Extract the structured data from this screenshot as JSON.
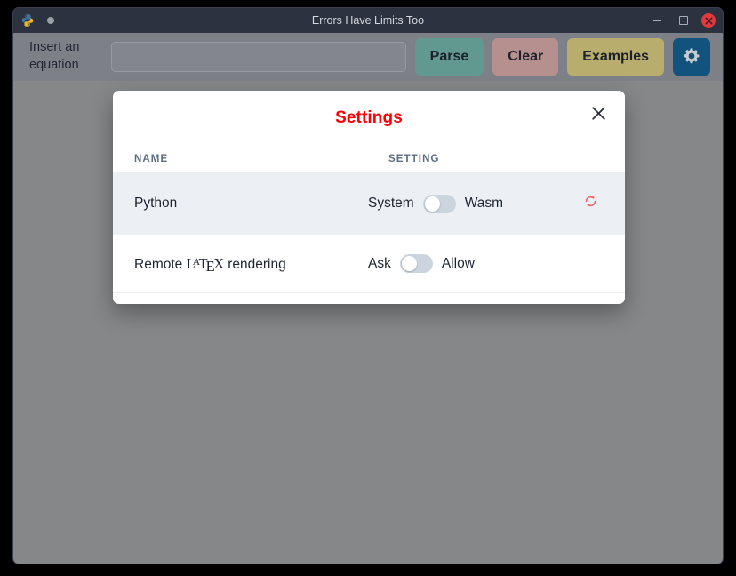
{
  "window": {
    "title": "Errors Have Limits Too",
    "app_icon": "python-logo-icon",
    "controls": {
      "minimize": "minimize-icon",
      "maximize": "maximize-icon",
      "close": "close-icon"
    }
  },
  "toolbar": {
    "insert_label": "Insert an equation",
    "equation_input_value": "",
    "equation_input_placeholder": "",
    "parse_label": "Parse",
    "clear_label": "Clear",
    "examples_label": "Examples",
    "settings_icon": "gear-icon"
  },
  "dialog": {
    "title": "Settings",
    "close_icon": "close-icon",
    "columns": {
      "name": "NAME",
      "setting": "SETTING"
    },
    "rows": [
      {
        "name": "Python",
        "left_option": "System",
        "right_option": "Wasm",
        "toggle_state": "left",
        "action_icon": "refresh-icon",
        "highlighted": true
      },
      {
        "name_prefix": "Remote ",
        "name_logo": "LaTeX",
        "name_suffix": " rendering",
        "left_option": "Ask",
        "right_option": "Allow",
        "toggle_state": "left",
        "highlighted": false
      }
    ]
  },
  "colors": {
    "titlebar": "#2c323f",
    "toolbar": "#7d8187",
    "content": "#858789",
    "accent_red": "#fb0007",
    "parse": "#61988f",
    "clear": "#b6908e",
    "examples": "#b8ad6c",
    "gear_button": "#11537c",
    "row_highlight": "#ecf0f5",
    "toggle_track": "#ccd5de",
    "refresh_icon": "#f0656b"
  }
}
